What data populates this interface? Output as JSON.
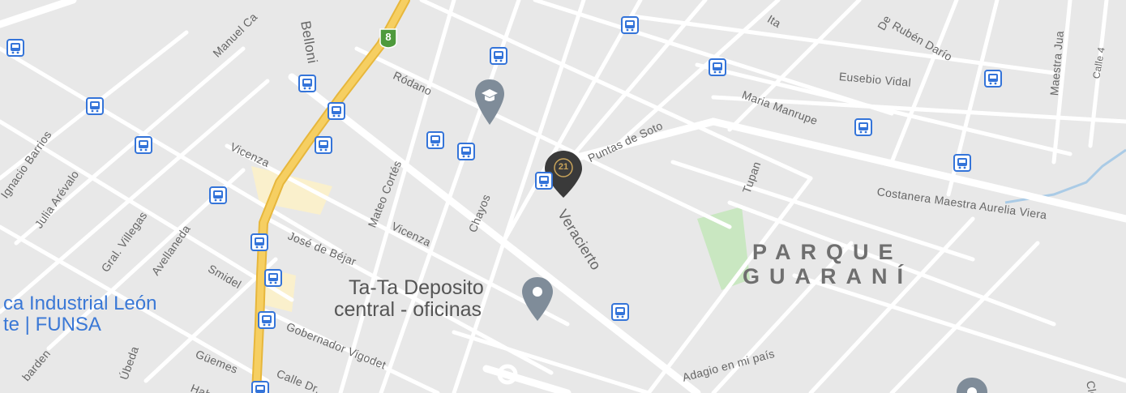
{
  "streets": [
    "Belloni",
    "Manuel Ca",
    "Ródano",
    "Vicenza",
    "Vicenza",
    "José de Béjar",
    "Mateo Cortés",
    "Chayos",
    "Puntas de Soto",
    "Veracierto",
    "Tupan",
    "Maria Manrupe",
    "Eusebio Vidal",
    "Rubén Darío",
    "Costanera Maestra Aurelia Viera",
    "Maestra Jua",
    "Calle 4",
    "Ignacio Barrios",
    "Julia Arévalo",
    "Gral. Villegas",
    "Avellaneda",
    "Smidel",
    "Gobernador Vigodet",
    "Güemes",
    "Calle Dr.",
    "Adagio en mi país",
    "Clem",
    "barden",
    "Úbeda",
    "Haba",
    "Ita",
    "De"
  ],
  "route_shield": "8",
  "places": {
    "funsa_line1": "ca Industrial León",
    "funsa_line2": "te | FUNSA",
    "tata_line1": "Ta-Ta Deposito",
    "tata_line2": "central - oficinas",
    "district_line1": "PARQUE",
    "district_line2": "GUARANÍ"
  },
  "marker_label": "21",
  "icons": {
    "bus": "bus-stop-icon",
    "school": "school-icon",
    "place": "place-pin-icon",
    "marker": "century21-marker-icon"
  },
  "colors": {
    "background": "#e8e8e8",
    "road": "#ffffff",
    "highway": "#f6cf62",
    "park": "#c9e7c1",
    "water": "#aacbe6",
    "bus": "#3474d9",
    "pin": "#7f8c99",
    "marker": "#3a3a3a"
  }
}
